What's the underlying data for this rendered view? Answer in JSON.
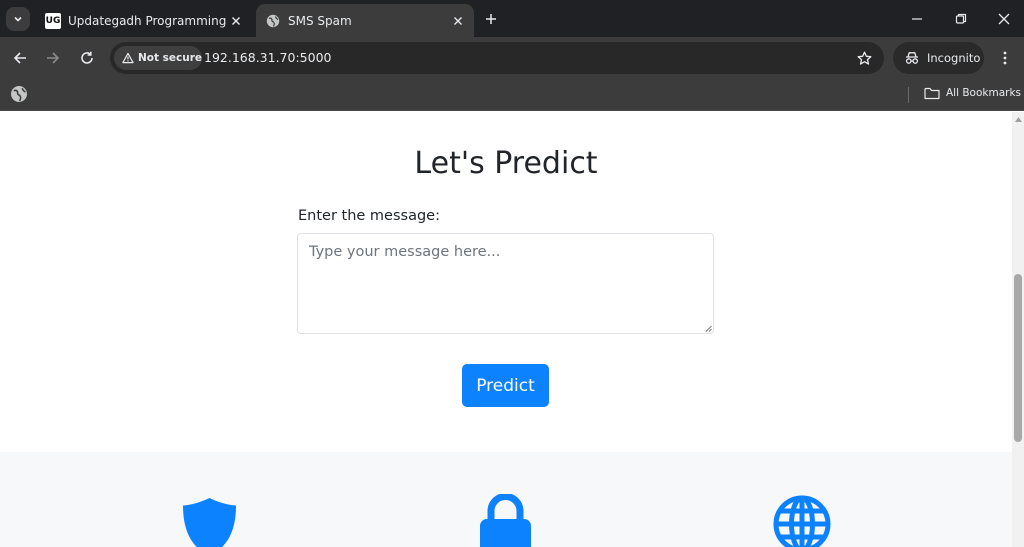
{
  "browser": {
    "tabs": [
      {
        "title": "Updategadh Programming - Updategadh",
        "favicon_text": "UG",
        "active": false
      },
      {
        "title": "SMS Spam",
        "active": true
      }
    ],
    "address_bar": {
      "security_label": "Not secure",
      "url": "192.168.31.70:5000"
    },
    "profile_label": "Incognito",
    "bookmarks_bar": {
      "all_bookmarks_label": "All Bookmarks"
    }
  },
  "page": {
    "heading": "Let's Predict",
    "form": {
      "message_label": "Enter the message:",
      "message_placeholder": "Type your message here...",
      "message_value": "",
      "submit_label": "Predict"
    },
    "features": [
      {
        "icon": "shield-icon"
      },
      {
        "icon": "lock-icon"
      },
      {
        "icon": "globe-icon"
      }
    ]
  },
  "colors": {
    "accent": "#0d82ff",
    "tabstrip_bg": "#202124",
    "toolbar_bg": "#3c3c3c",
    "features_bg": "#f7f8fa"
  }
}
